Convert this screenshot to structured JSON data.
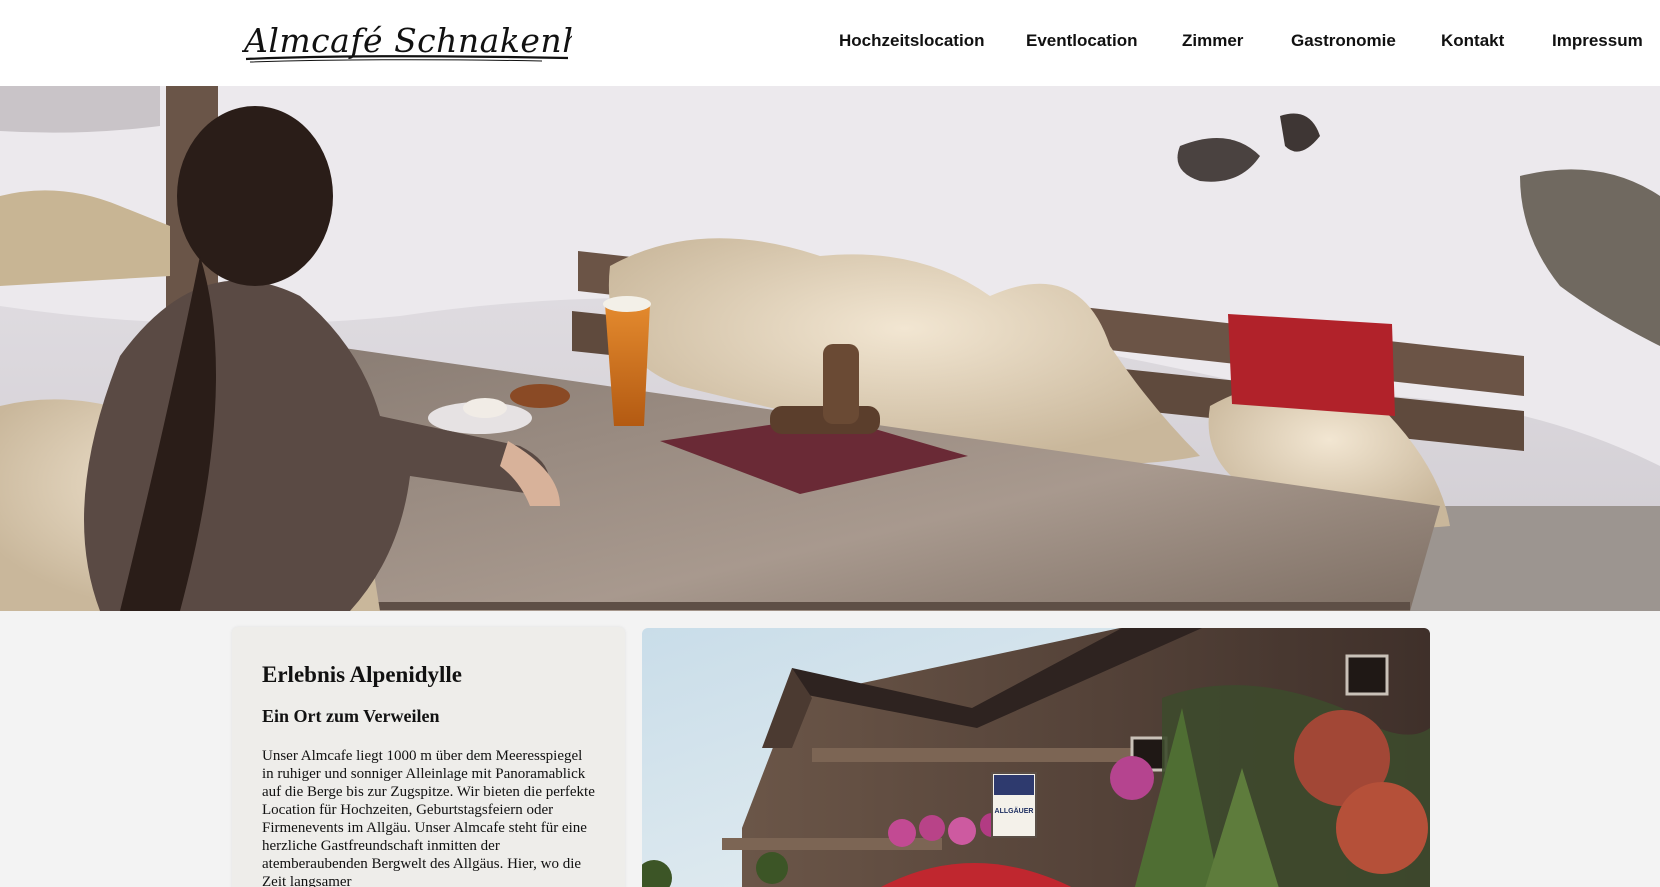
{
  "header": {
    "logo_text": "Almcafé Schnakenhöhe",
    "nav": [
      {
        "label": "Hochzeitslocation"
      },
      {
        "label": "Eventlocation"
      },
      {
        "label": "Zimmer"
      },
      {
        "label": "Gastronomie"
      },
      {
        "label": "Kontakt"
      },
      {
        "label": "Impressum"
      }
    ]
  },
  "hero": {
    "image": "terrace-winter-photo"
  },
  "intro": {
    "title": "Erlebnis Alpenidylle",
    "subtitle": "Ein Ort zum Verweilen",
    "body": "Unser Almcafe liegt 1000 m über dem Meeresspiegel in ruhiger und sonniger Alleinlage mit Panoramablick auf die Berge bis zur Zugspitze. Wir bieten die perfekte Location für Hochzeiten, Geburtstagsfeiern oder Firmenevents im Allgäu. Unser Almcafe steht für eine herzliche Gastfreundschaft inmitten der atemberaubenden Bergwelt des Allgäus. Hier, wo die Zeit langsamer"
  },
  "photo": {
    "image": "chalet-exterior-photo",
    "sign_text": "ALLGÄUER"
  },
  "colors": {
    "header_bg": "#ffffff",
    "page_bg": "#f3f3f3",
    "card_bg": "#eeedea",
    "text": "#111111"
  }
}
